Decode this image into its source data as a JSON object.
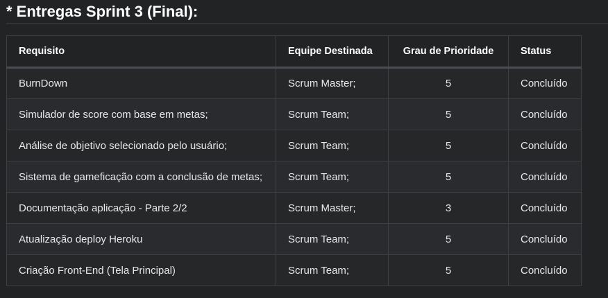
{
  "heading": "* Entregas Sprint 3 (Final):",
  "table": {
    "headers": [
      "Requisito",
      "Equipe Destinada",
      "Grau de Prioridade",
      "Status"
    ],
    "rows": [
      [
        "BurnDown",
        "Scrum Master;",
        "5",
        "Concluído"
      ],
      [
        "Simulador de score com base em metas;",
        "Scrum Team;",
        "5",
        "Concluído"
      ],
      [
        "Análise de objetivo selecionado pelo usuário;",
        "Scrum Team;",
        "5",
        "Concluído"
      ],
      [
        "Sistema de gameficação com a conclusão de metas;",
        "Scrum Team;",
        "5",
        "Concluído"
      ],
      [
        "Documentação aplicação - Parte 2/2",
        "Scrum Master;",
        "3",
        "Concluído"
      ],
      [
        "Atualização deploy Heroku",
        "Scrum Team;",
        "5",
        "Concluído"
      ],
      [
        "Criação Front-End (Tela Principal)",
        "Scrum Team;",
        "5",
        "Concluído"
      ]
    ]
  }
}
